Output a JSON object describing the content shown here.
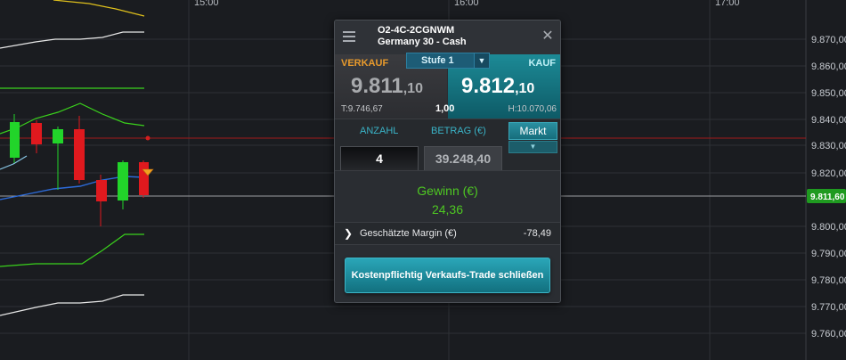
{
  "chart": {
    "time_labels": [
      "15:00",
      "16:00",
      "17:00"
    ],
    "price_labels": [
      "9.870,00",
      "9.860,00",
      "9.850,00",
      "9.840,00",
      "9.830,00",
      "9.820,00",
      "9.800,00",
      "9.790,00",
      "9.780,00",
      "9.770,00",
      "9.760,00"
    ],
    "current_price_label": "9.811,60",
    "colors": {
      "background": "#1a1c20",
      "grid": "#2e3136",
      "bull": "#22d42a",
      "bear": "#e0191e",
      "bollinger": "#3ad21c",
      "envelope": "#e8e8e8",
      "ma": "#2d6bd9",
      "ma2": "#8ac8e8",
      "sr_line": "#d21e1e",
      "current_line": "#d0d0d0",
      "yellow": "#e0c11c"
    }
  },
  "panel": {
    "symbol": "O2-4C-2CGNWM",
    "instrument": "Germany 30 - Cash",
    "sell_label": "VERKAUF",
    "buy_label": "KAUF",
    "stufe": "Stufe 1",
    "sell_price_main": "9.811",
    "sell_price_frac": ",10",
    "buy_price_main": "9.812",
    "buy_price_frac": ",10",
    "low": "T:9.746,67",
    "size": "1,00",
    "high": "H:10.070,06",
    "qty_label": "ANZAHL",
    "amount_label": "BETRAG (€)",
    "order_type": "Markt",
    "qty_value": "4",
    "amount_value": "39.248,40",
    "gain_label": "Gewinn (€)",
    "gain_value": "24,36",
    "margin_label": "Geschätzte Margin (€)",
    "margin_value": "-78,49",
    "close_button": "Kostenpflichtig Verkaufs-Trade schließen",
    "icons": {
      "menu": "menu-icon",
      "close": "close-icon",
      "dropdown": "chevron-down-icon",
      "expand": "chevron-right-icon"
    }
  }
}
